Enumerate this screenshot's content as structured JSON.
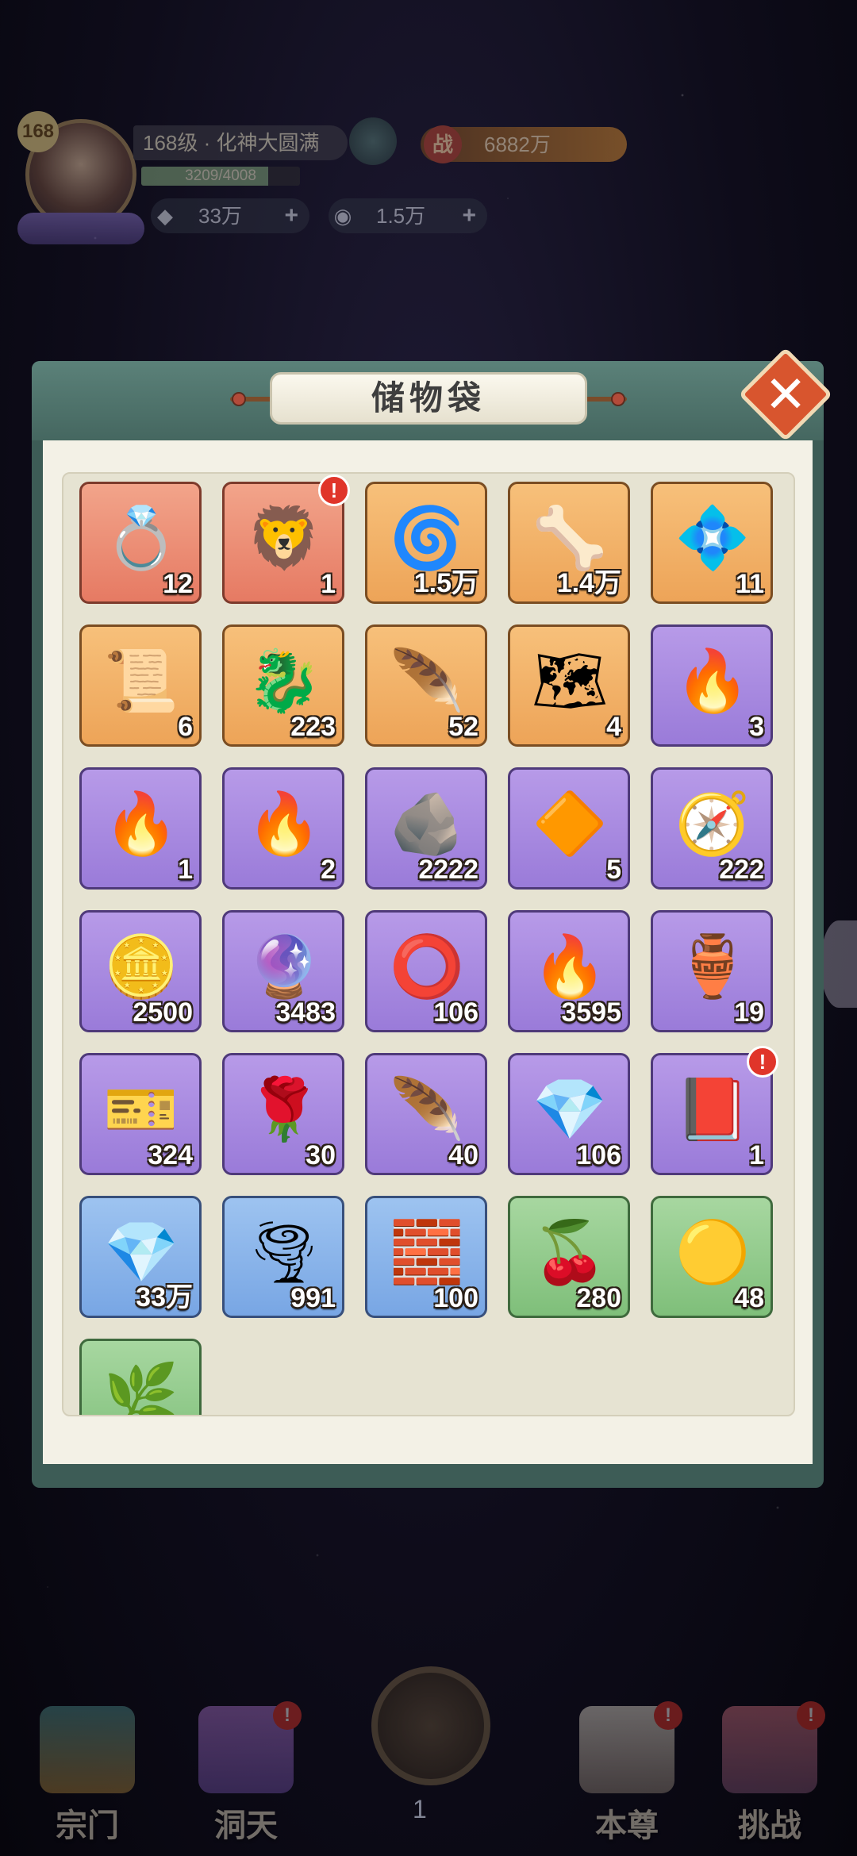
{
  "hud": {
    "level_badge": "168",
    "level_text": "168级 · 化神大圆满",
    "exp_text": "3209/4008",
    "exp_progress": 0.8006,
    "power_icon": "战",
    "power_value": "6882万",
    "currency1_icon": "diamond-icon",
    "currency1_value": "33万",
    "currency2_icon": "spirit-coin-icon",
    "currency2_value": "1.5万",
    "plus_label": "+"
  },
  "panel": {
    "title": "储物袋",
    "close_label": "✕"
  },
  "items": [
    {
      "icon": "gold-ring-icon",
      "glyph": "💍",
      "rarity": "red",
      "qty": "12",
      "alert": false
    },
    {
      "icon": "lion-armor-icon",
      "glyph": "🦁",
      "rarity": "red",
      "qty": "1",
      "alert": true
    },
    {
      "icon": "wave-orb-icon",
      "glyph": "🌀",
      "rarity": "orange",
      "qty": "1.5万",
      "alert": false
    },
    {
      "icon": "bone-claw-icon",
      "glyph": "🦴",
      "rarity": "orange",
      "qty": "1.4万",
      "alert": false
    },
    {
      "icon": "blue-crystal-icon",
      "glyph": "💠",
      "rarity": "orange",
      "qty": "11",
      "alert": false
    },
    {
      "icon": "law-talisman-icon",
      "glyph": "📜",
      "rarity": "orange",
      "qty": "6",
      "alert": false
    },
    {
      "icon": "jade-lion-icon",
      "glyph": "🐉",
      "rarity": "orange",
      "qty": "223",
      "alert": false
    },
    {
      "icon": "phoenix-ring-icon",
      "glyph": "🪶",
      "rarity": "orange",
      "qty": "52",
      "alert": false
    },
    {
      "icon": "scroll-map-icon",
      "glyph": "🗺",
      "rarity": "orange",
      "qty": "4",
      "alert": false
    },
    {
      "icon": "green-flame-icon",
      "glyph": "🔥",
      "rarity": "purple",
      "qty": "3",
      "alert": false
    },
    {
      "icon": "blue-flame-icon",
      "glyph": "🔥",
      "rarity": "purple",
      "qty": "1",
      "alert": false
    },
    {
      "icon": "red-flame-icon",
      "glyph": "🔥",
      "rarity": "purple",
      "qty": "2",
      "alert": false
    },
    {
      "icon": "gray-ore-icon",
      "glyph": "🪨",
      "rarity": "purple",
      "qty": "2222",
      "alert": false
    },
    {
      "icon": "gold-crystal-icon",
      "glyph": "🔶",
      "rarity": "purple",
      "qty": "5",
      "alert": false
    },
    {
      "icon": "compass-icon",
      "glyph": "🧭",
      "rarity": "purple",
      "qty": "222",
      "alert": false
    },
    {
      "icon": "token-coin-icon",
      "glyph": "🪙",
      "rarity": "purple",
      "qty": "2500",
      "alert": false
    },
    {
      "icon": "purple-orb-icon",
      "glyph": "🔮",
      "rarity": "purple",
      "qty": "3483",
      "alert": false
    },
    {
      "icon": "dark-ring-icon",
      "glyph": "⭕",
      "rarity": "purple",
      "qty": "106",
      "alert": false
    },
    {
      "icon": "fire-core-icon",
      "glyph": "🔥",
      "rarity": "purple",
      "qty": "3595",
      "alert": false
    },
    {
      "icon": "jade-vase-icon",
      "glyph": "🏺",
      "rarity": "purple",
      "qty": "19",
      "alert": false
    },
    {
      "icon": "gold-token-icon",
      "glyph": "🎫",
      "rarity": "purple",
      "qty": "324",
      "alert": false
    },
    {
      "icon": "rose-orb-icon",
      "glyph": "🌹",
      "rarity": "purple",
      "qty": "30",
      "alert": false
    },
    {
      "icon": "spirit-feather-icon",
      "glyph": "🪶",
      "rarity": "purple",
      "qty": "40",
      "alert": false
    },
    {
      "icon": "flame-crystal-icon",
      "glyph": "💎",
      "rarity": "purple",
      "qty": "106",
      "alert": false
    },
    {
      "icon": "purple-book-icon",
      "glyph": "📕",
      "rarity": "purple",
      "qty": "1",
      "alert": true
    },
    {
      "icon": "ice-crystal-icon",
      "glyph": "💎",
      "rarity": "blue",
      "qty": "33万",
      "alert": false
    },
    {
      "icon": "wind-swirl-icon",
      "glyph": "🌪",
      "rarity": "blue",
      "qty": "991",
      "alert": false
    },
    {
      "icon": "stone-slab-icon",
      "glyph": "🧱",
      "rarity": "blue",
      "qty": "100",
      "alert": false
    },
    {
      "icon": "red-berry-icon",
      "glyph": "🍒",
      "rarity": "green",
      "qty": "280",
      "alert": false
    },
    {
      "icon": "gold-dragon-orb-icon",
      "glyph": "🟡",
      "rarity": "green",
      "qty": "48",
      "alert": false
    },
    {
      "icon": "green-leaf-icon",
      "glyph": "🌿",
      "rarity": "green",
      "qty": "",
      "alert": false
    }
  ],
  "nav": {
    "items": [
      {
        "label": "宗门",
        "icon": "sect-gate-icon",
        "alert": false
      },
      {
        "label": "洞天",
        "icon": "cave-tree-icon",
        "alert": true
      },
      {
        "label": "本尊",
        "icon": "hero-portrait-icon",
        "alert": true
      },
      {
        "label": "挑战",
        "icon": "challenge-sword-icon",
        "alert": true
      }
    ],
    "center_value": "1",
    "alert_label": "!"
  }
}
